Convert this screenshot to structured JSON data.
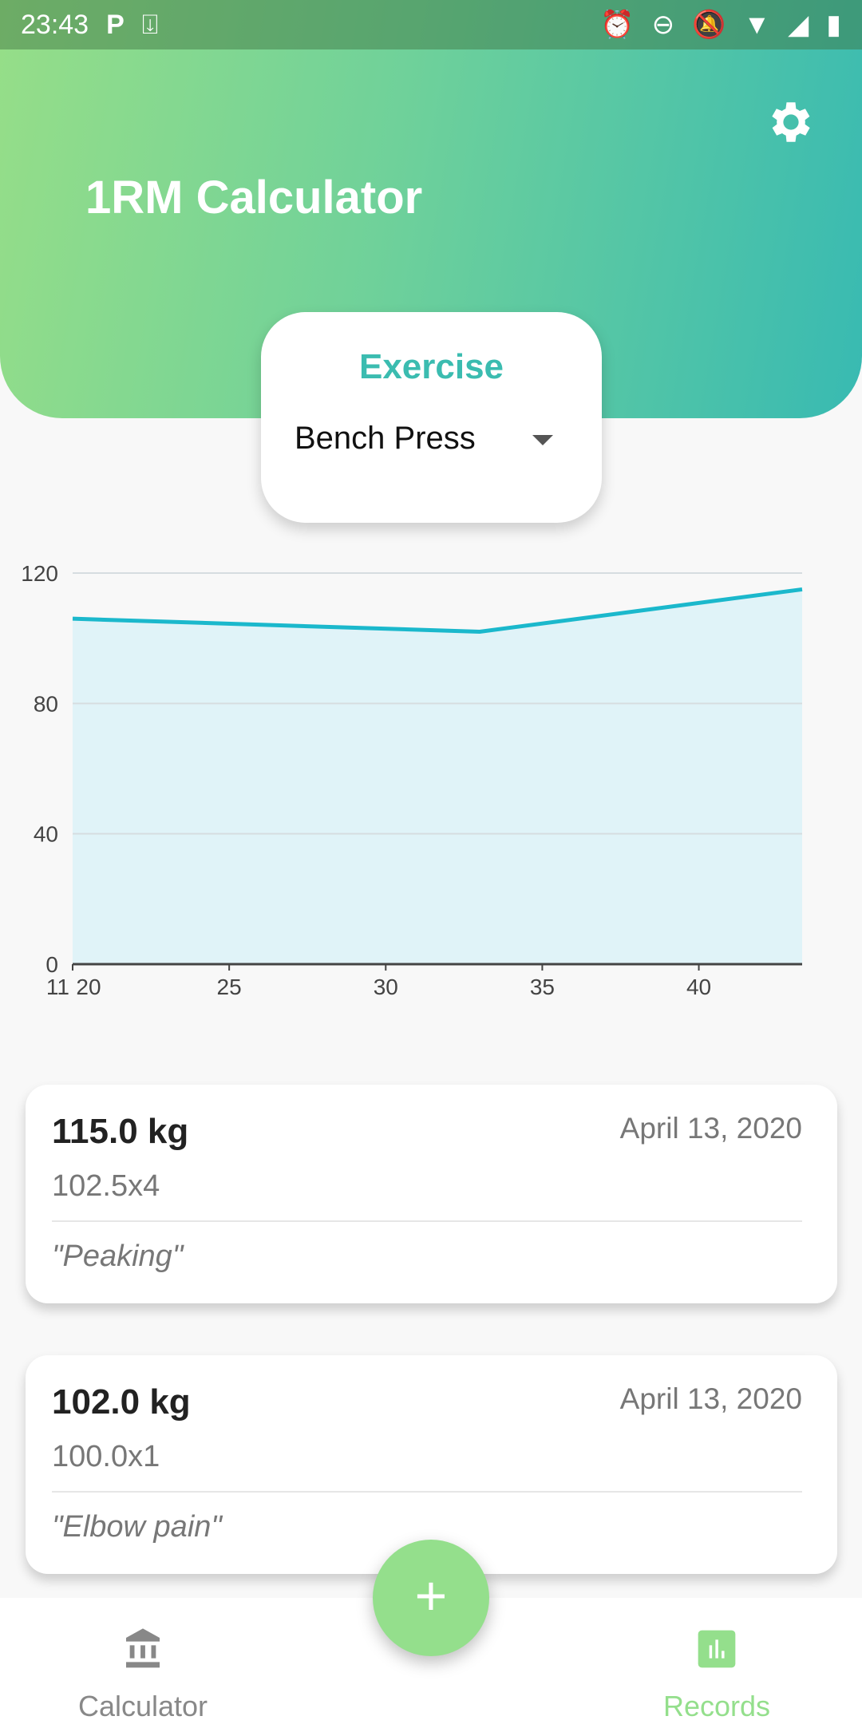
{
  "status_bar": {
    "time": "23:43"
  },
  "header": {
    "title": "1RM Calculator"
  },
  "exercise": {
    "label": "Exercise",
    "value": "Bench Press"
  },
  "chart_data": {
    "type": "area",
    "x": [
      20,
      33,
      43.3
    ],
    "y": [
      106,
      102,
      115
    ],
    "xticks": [
      20,
      25,
      30,
      35,
      40
    ],
    "yticks": [
      0,
      40,
      80,
      120
    ],
    "ylim": [
      0,
      120
    ],
    "xlim": [
      20,
      43.3
    ],
    "extra_x_label": "11",
    "grid": true,
    "color": "#1bb8cc",
    "fill": "#e0f3f8"
  },
  "records": [
    {
      "weight": "115.0 kg",
      "date": "April 13, 2020",
      "reps": "102.5x4",
      "note": "\"Peaking\""
    },
    {
      "weight": "102.0 kg",
      "date": "April 13, 2020",
      "reps": "100.0x1",
      "note": "\"Elbow pain\""
    }
  ],
  "nav": {
    "calculator": "Calculator",
    "records": "Records",
    "fab": "+"
  },
  "colors": {
    "accent": "#3bbcb0",
    "green": "#94df8c"
  }
}
